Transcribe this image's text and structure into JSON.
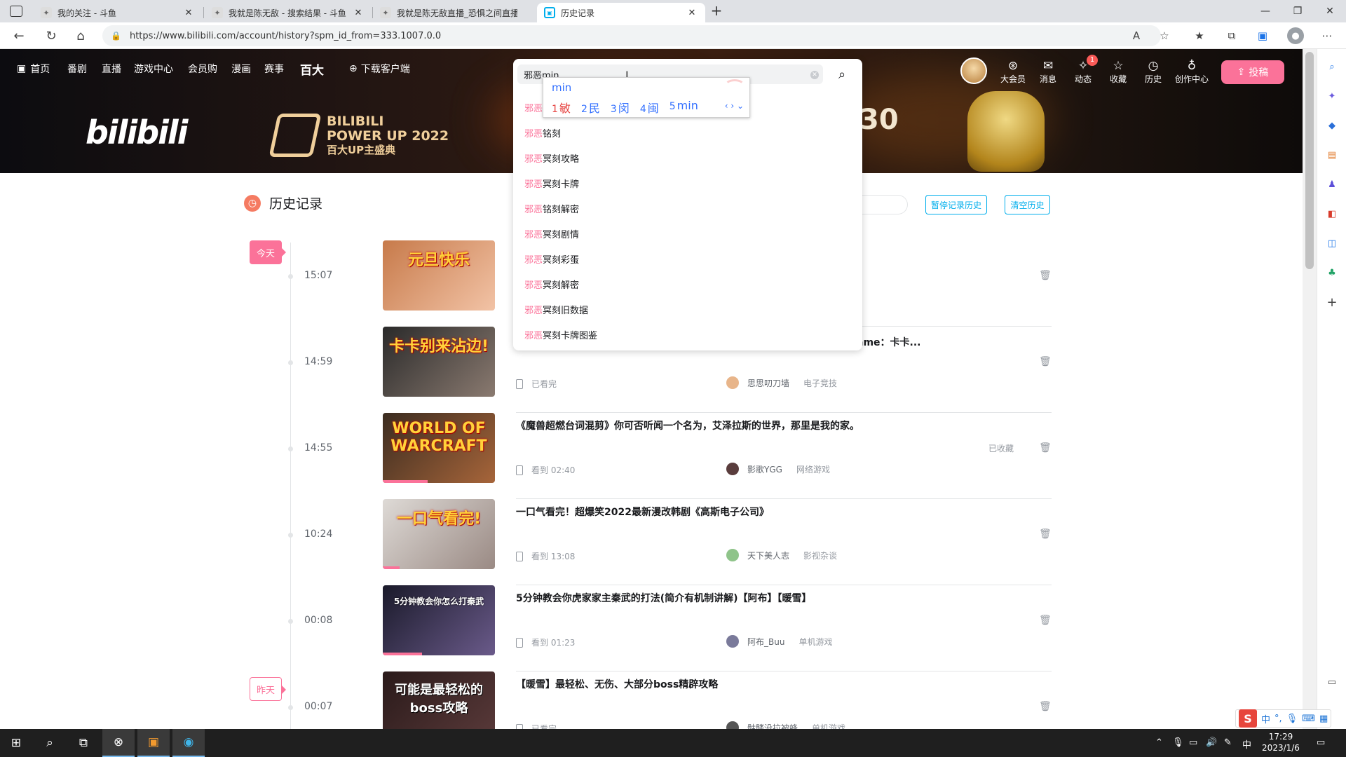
{
  "browser": {
    "tabs": [
      {
        "title": "我的关注 - 斗鱼",
        "active": false
      },
      {
        "title": "我就是陈无敌 - 搜索结果 - 斗鱼",
        "active": false
      },
      {
        "title": "我就是陈无敌直播_恐惧之间直播",
        "active": false
      },
      {
        "title": "历史记录",
        "active": true
      }
    ],
    "url": "https://www.bilibili.com/account/history?spm_id_from=333.1007.0.0"
  },
  "header": {
    "nav": [
      "首页",
      "番剧",
      "直播",
      "游戏中心",
      "会员购",
      "漫画",
      "赛事",
      "百大",
      "下载客户端"
    ],
    "right": [
      {
        "label": "大会员",
        "icon": "vip-icon"
      },
      {
        "label": "消息",
        "icon": "message-icon"
      },
      {
        "label": "动态",
        "icon": "dynamic-icon",
        "badge": "1"
      },
      {
        "label": "收藏",
        "icon": "favorite-icon"
      },
      {
        "label": "历史",
        "icon": "history-icon"
      },
      {
        "label": "创作中心",
        "icon": "creator-icon"
      }
    ],
    "upload_label": "投稿",
    "banner": {
      "logo": "bilibili",
      "line1": "BILIBILI",
      "line2": "POWER UP 2022",
      "line3": "百大UP主盛典",
      "clock": ":30",
      "accent": "#fb7299"
    }
  },
  "search": {
    "value": "邪恶min",
    "ime": {
      "composition": "min",
      "candidates": [
        {
          "num": "1",
          "text": "敏"
        },
        {
          "num": "2",
          "text": "民"
        },
        {
          "num": "3",
          "text": "闵"
        },
        {
          "num": "4",
          "text": "闽"
        },
        {
          "num": "5",
          "text": "min"
        }
      ]
    },
    "suggestions": [
      {
        "hl": "邪恶",
        "rest": "铭刻"
      },
      {
        "hl": "邪恶",
        "rest": "铭刻"
      },
      {
        "hl": "邪恶",
        "rest": "冥刻攻略"
      },
      {
        "hl": "邪恶",
        "rest": "冥刻卡牌"
      },
      {
        "hl": "邪恶",
        "rest": "铭刻解密"
      },
      {
        "hl": "邪恶",
        "rest": "冥刻剧情"
      },
      {
        "hl": "邪恶",
        "rest": "冥刻彩蛋"
      },
      {
        "hl": "邪恶",
        "rest": "冥刻解密"
      },
      {
        "hl": "邪恶",
        "rest": "冥刻旧数据"
      },
      {
        "hl": "邪恶",
        "rest": "冥刻卡牌图鉴"
      }
    ]
  },
  "history": {
    "page_title": "历史记录",
    "pause_label": "暂停记录历史",
    "clear_label": "清空历史",
    "day_today": "今天",
    "day_yesterday": "昨天",
    "items": [
      {
        "time": "15:07",
        "title": "",
        "device_text": "",
        "uploader": "",
        "category": "",
        "fav": "",
        "thumb_caption": "元旦快乐",
        "thumb_colors": [
          "#c77a4a",
          "#f2c3a6"
        ]
      },
      {
        "time": "14:59",
        "title": "ame：卡卡...",
        "device_text": "已看完",
        "uploader": "思思叨刀墙",
        "category": "电子竞技",
        "fav": "",
        "thumb_caption": "卡卡别来沾边!",
        "thumb_colors": [
          "#2a2a2a",
          "#8a7a70"
        ]
      },
      {
        "time": "14:55",
        "title": "《魔兽超燃台词混剪》你可否听闻一个名为，艾泽拉斯的世界，那里是我的家。",
        "device_text": "看到 02:40",
        "uploader": "影歌YGG",
        "category": "网络游戏",
        "fav": "已收藏",
        "thumb_caption": "WORLD OF WARCRAFT",
        "thumb_colors": [
          "#3b2c20",
          "#a7653a"
        ],
        "progress": 0.4
      },
      {
        "time": "10:24",
        "title": "一口气看完！超爆笑2022最新漫改韩剧《高斯电子公司》",
        "device_text": "看到 13:08",
        "uploader": "天下美人志",
        "category": "影视杂谈",
        "fav": "",
        "thumb_caption": "一口气看完!",
        "thumb_colors": [
          "#dedad6",
          "#9a8a84"
        ],
        "progress": 0.15
      },
      {
        "time": "00:08",
        "title": "5分钟教会你虎家家主秦武的打法(简介有机制讲解)【阿布】【暖雪】",
        "device_text": "看到 01:23",
        "uploader": "阿布_Buu",
        "category": "单机游戏",
        "fav": "",
        "thumb_caption": "5分钟教会你怎么打秦武",
        "thumb_colors": [
          "#1a1a2a",
          "#6a5a8a"
        ],
        "progress": 0.35
      },
      {
        "time": "00:07",
        "title": "【暖雪】最轻松、无伤、大部分boss精辟攻略",
        "device_text": "已看完",
        "uploader": "骷髅没拉被蜂",
        "category": "单机游戏",
        "fav": "",
        "thumb_caption": "可能是最轻松的boss攻略",
        "thumb_colors": [
          "#2a1a1a",
          "#5a3a3a"
        ]
      }
    ]
  },
  "taskbar": {
    "time": "17:29",
    "date": "2023/1/6",
    "ime_indicator": "中"
  },
  "ime_toolbar": {
    "mode": "中",
    "logo": "S"
  }
}
